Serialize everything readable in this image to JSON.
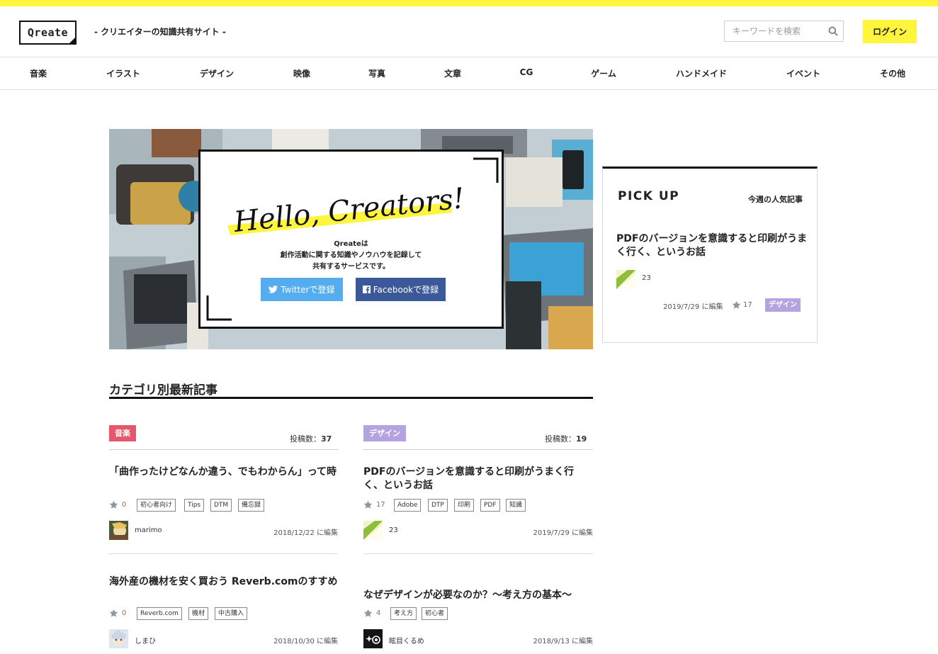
{
  "brand": {
    "logo": "Qreate",
    "tagline": "- クリエイターの知識共有サイト -",
    "accent": "#fff53d"
  },
  "search": {
    "placeholder": "キーワードを検索"
  },
  "login_label": "ログイン",
  "nav": [
    "音楽",
    "イラスト",
    "デザイン",
    "映像",
    "写真",
    "文章",
    "CG",
    "ゲーム",
    "ハンドメイド",
    "イベント",
    "その他"
  ],
  "hero": {
    "headline": "Hello, Creators!",
    "line1": "Qreateは",
    "line2": "創作活動に関する知識やノウハウを記録して",
    "line3": "共有するサービスです。",
    "twitter_label": "Twitterで登録",
    "facebook_label": "Facebookで登録"
  },
  "pickup": {
    "title": "PICK UP",
    "subtitle": "今週の人気記事",
    "article_title": "PDFのバージョンを意識すると印刷がうまく行く、というお話",
    "author": "23",
    "date": "2019/7/29 に編集",
    "stars": "17",
    "category": "デザイン"
  },
  "section_title": "カテゴリ別最新記事",
  "columns": [
    {
      "category": "音楽",
      "category_color": "#e8566e",
      "count_label": "投稿数：",
      "count": "37",
      "articles": [
        {
          "title": "「曲作ったけどなんか違う、でもわからん」って時",
          "stars": "0",
          "tags": [
            "初心者向け",
            "Tips",
            "DTM",
            "備忘録"
          ],
          "author": "marimo",
          "date": "2018/12/22 に編集"
        },
        {
          "title": "海外産の機材を安く買おう Reverb.comのすすめ",
          "stars": "0",
          "tags": [
            "Reverb.com",
            "機材",
            "中古購入"
          ],
          "author": "しまひ",
          "date": "2018/10/30 に編集"
        }
      ]
    },
    {
      "category": "デザイン",
      "category_color": "#b4a3e0",
      "count_label": "投稿数：",
      "count": "19",
      "articles": [
        {
          "title": "PDFのバージョンを意識すると印刷がうまく行く、というお話",
          "stars": "17",
          "tags": [
            "Adobe",
            "DTP",
            "印刷",
            "PDF",
            "知識"
          ],
          "author": "23",
          "date": "2019/7/29 に編集"
        },
        {
          "title": "なぜデザインが必要なのか？〜考え方の基本〜",
          "stars": "4",
          "tags": [
            "考え方",
            "初心者"
          ],
          "author": "眩目くるめ",
          "date": "2018/9/13 に編集"
        }
      ]
    }
  ]
}
